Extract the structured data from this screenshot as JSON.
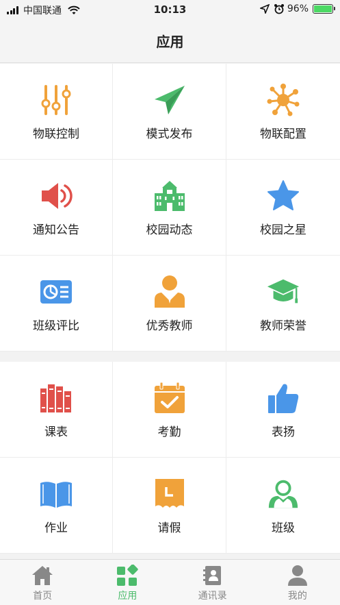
{
  "status": {
    "carrier": "中国联通",
    "time": "10:13",
    "battery_pct": "96%"
  },
  "header": {
    "title": "应用"
  },
  "apps_group1": [
    {
      "label": "物联控制",
      "icon": "sliders-icon",
      "color": "#f0a23a"
    },
    {
      "label": "模式发布",
      "icon": "paper-plane-icon",
      "color": "#4cbb6c"
    },
    {
      "label": "物联配置",
      "icon": "network-icon",
      "color": "#f0a23a"
    },
    {
      "label": "通知公告",
      "icon": "speaker-icon",
      "color": "#e0504a"
    },
    {
      "label": "校园动态",
      "icon": "school-building-icon",
      "color": "#4cbb6c"
    },
    {
      "label": "校园之星",
      "icon": "star-icon",
      "color": "#4a96e8"
    },
    {
      "label": "班级评比",
      "icon": "chart-card-icon",
      "color": "#4a96e8"
    },
    {
      "label": "优秀教师",
      "icon": "teacher-icon",
      "color": "#f0a23a"
    },
    {
      "label": "教师荣誉",
      "icon": "graduation-cap-icon",
      "color": "#4cbb6c"
    }
  ],
  "apps_group2": [
    {
      "label": "课表",
      "icon": "books-icon",
      "color": "#e0504a"
    },
    {
      "label": "考勤",
      "icon": "calendar-check-icon",
      "color": "#f0a23a"
    },
    {
      "label": "表扬",
      "icon": "thumbs-up-icon",
      "color": "#4a96e8"
    },
    {
      "label": "作业",
      "icon": "open-book-icon",
      "color": "#4a96e8"
    },
    {
      "label": "请假",
      "icon": "leave-clock-icon",
      "color": "#f0a23a"
    },
    {
      "label": "班级",
      "icon": "group-icon",
      "color": "#4cbb6c"
    }
  ],
  "tabbar": [
    {
      "label": "首页",
      "icon": "home-icon",
      "active": false
    },
    {
      "label": "应用",
      "icon": "apps-icon",
      "active": true
    },
    {
      "label": "通讯录",
      "icon": "contacts-icon",
      "active": false
    },
    {
      "label": "我的",
      "icon": "profile-icon",
      "active": false
    }
  ]
}
